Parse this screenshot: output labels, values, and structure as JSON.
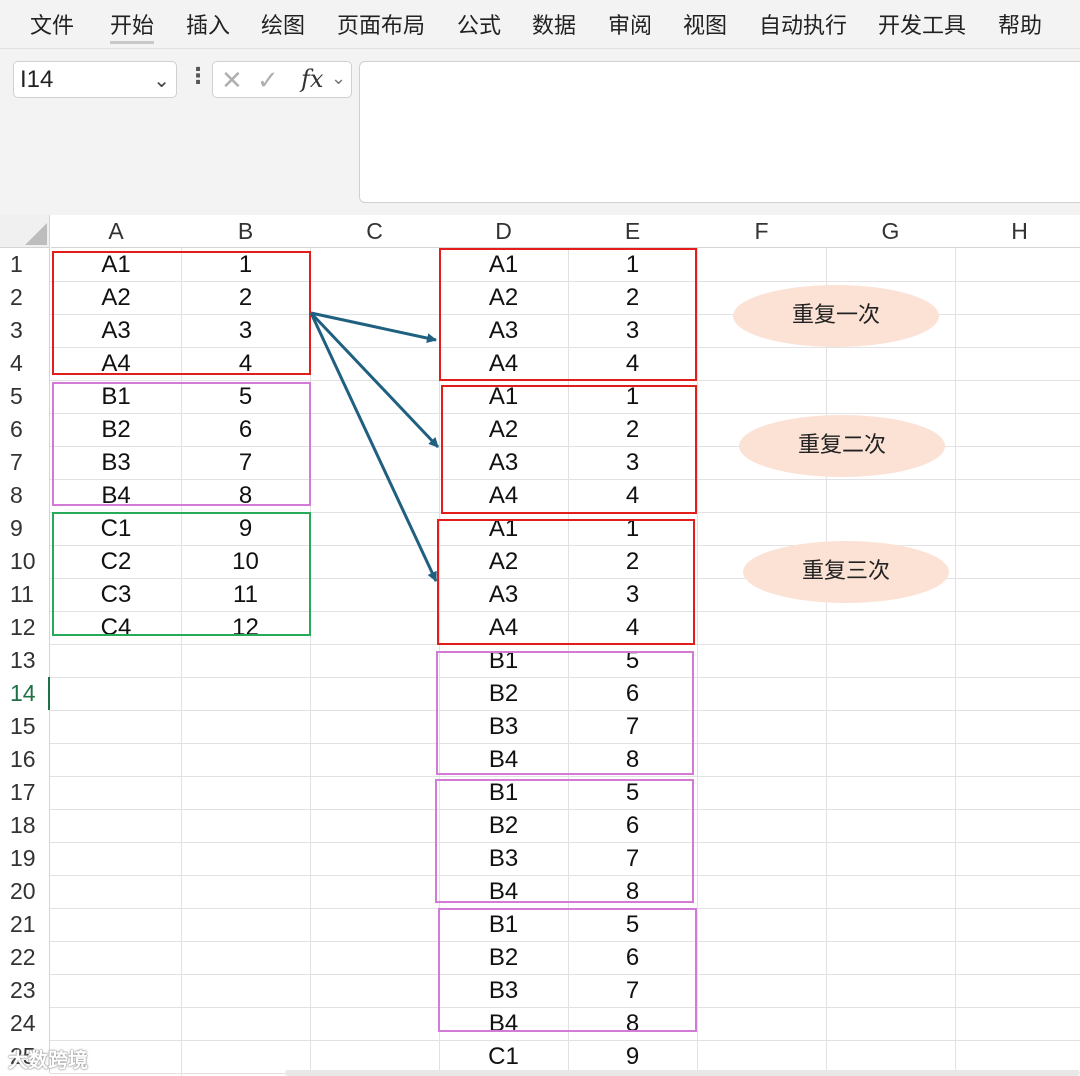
{
  "menu": [
    "文件",
    "开始",
    "插入",
    "绘图",
    "页面布局",
    "公式",
    "数据",
    "审阅",
    "视图",
    "自动执行",
    "开发工具",
    "帮助"
  ],
  "formula_bar": {
    "name_box": "I14",
    "fx_label": "fx",
    "formula": ""
  },
  "columns": [
    "A",
    "B",
    "C",
    "D",
    "E",
    "F",
    "G",
    "H"
  ],
  "rows": [
    "1",
    "2",
    "3",
    "4",
    "5",
    "6",
    "7",
    "8",
    "9",
    "10",
    "11",
    "12",
    "13",
    "14",
    "15",
    "16",
    "17",
    "18",
    "19",
    "20",
    "21",
    "22",
    "23",
    "24",
    "25"
  ],
  "selected_row": "14",
  "col_A": [
    "A1",
    "A2",
    "A3",
    "A4",
    "B1",
    "B2",
    "B3",
    "B4",
    "C1",
    "C2",
    "C3",
    "C4"
  ],
  "col_B": [
    "1",
    "2",
    "3",
    "4",
    "5",
    "6",
    "7",
    "8",
    "9",
    "10",
    "11",
    "12"
  ],
  "col_D": [
    "A1",
    "A2",
    "A3",
    "A4",
    "A1",
    "A2",
    "A3",
    "A4",
    "A1",
    "A2",
    "A3",
    "A4",
    "B1",
    "B2",
    "B3",
    "B4",
    "B1",
    "B2",
    "B3",
    "B4",
    "B1",
    "B2",
    "B3",
    "B4",
    "C1"
  ],
  "col_E": [
    "1",
    "2",
    "3",
    "4",
    "1",
    "2",
    "3",
    "4",
    "1",
    "2",
    "3",
    "4",
    "5",
    "6",
    "7",
    "8",
    "5",
    "6",
    "7",
    "8",
    "5",
    "6",
    "7",
    "8",
    "9"
  ],
  "annotations": [
    "重复一次",
    "重复二次",
    "重复三次"
  ],
  "colors": {
    "red_box": "#e31c1c",
    "violet_box": "#d27bd6",
    "green_box": "#27ab5a",
    "arrow": "#1f5f7f",
    "pill": "#fbe2d5"
  },
  "watermark": "大数跨境"
}
